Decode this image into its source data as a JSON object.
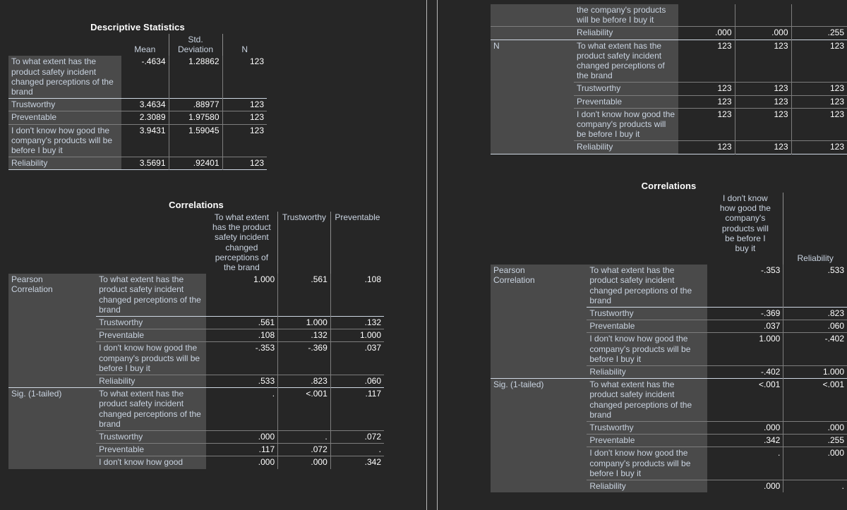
{
  "variables": {
    "v1": "To what extent has the product safety incident changed perceptions of the brand",
    "v2": "Trustworthy",
    "v3": "Preventable",
    "v4": "I don't know how good the company's products will be before I buy it",
    "v5": "Reliability"
  },
  "descriptives": {
    "title": "Descriptive Statistics",
    "columns": [
      "",
      "Mean",
      "Std. Deviation",
      "N"
    ],
    "col_mean": "Mean",
    "col_sd_line1": "Std.",
    "col_sd_line2": "Deviation",
    "col_n": "N",
    "rows": [
      {
        "label": "To what extent has the product safety incident changed perceptions of the brand",
        "mean": "-.4634",
        "sd": "1.28862",
        "n": "123"
      },
      {
        "label": "Trustworthy",
        "mean": "3.4634",
        "sd": ".88977",
        "n": "123"
      },
      {
        "label": "Preventable",
        "mean": "2.3089",
        "sd": "1.97580",
        "n": "123"
      },
      {
        "label": "I don't know how good the company's products will be before I buy it",
        "mean": "3.9431",
        "sd": "1.59045",
        "n": "123"
      },
      {
        "label": "Reliability",
        "mean": "3.5691",
        "sd": ".92401",
        "n": "123"
      }
    ]
  },
  "correlations_left": {
    "title": "Correlations",
    "columns": [
      "To what extent has the product safety incident changed perceptions of the brand",
      "Trustworthy",
      "Preventable"
    ],
    "sections": [
      {
        "name": "Pearson Correlation",
        "name_line1": "Pearson",
        "name_line2": "Correlation",
        "rows": [
          {
            "label": "To what extent has the product safety incident changed perceptions of the brand",
            "values": [
              "1.000",
              ".561",
              ".108"
            ]
          },
          {
            "label": "Trustworthy",
            "values": [
              ".561",
              "1.000",
              ".132"
            ]
          },
          {
            "label": "Preventable",
            "values": [
              ".108",
              ".132",
              "1.000"
            ]
          },
          {
            "label": "I don't know how good the company's products will be before I buy it",
            "values": [
              "-.353",
              "-.369",
              ".037"
            ]
          },
          {
            "label": "Reliability",
            "values": [
              ".533",
              ".823",
              ".060"
            ]
          }
        ]
      },
      {
        "name": "Sig. (1-tailed)",
        "name_line1": "Sig. (1-tailed)",
        "name_line2": "",
        "rows": [
          {
            "label": "To what extent has the product safety incident changed perceptions of the brand",
            "values": [
              ".",
              "<.001",
              ".117"
            ]
          },
          {
            "label": "Trustworthy",
            "values": [
              ".000",
              ".",
              ".072"
            ]
          },
          {
            "label": "Preventable",
            "values": [
              ".117",
              ".072",
              "."
            ]
          },
          {
            "label": "I don't know how good",
            "values": [
              ".000",
              ".000",
              ".342"
            ]
          }
        ]
      }
    ]
  },
  "correlations_right_top": {
    "columns": [
      "",
      "",
      ""
    ],
    "sig_tail_rows": [
      {
        "label": "the company's products will be before I buy it",
        "values": [
          "",
          "",
          ""
        ]
      },
      {
        "label": "Reliability",
        "values": [
          ".000",
          ".000",
          ".255"
        ]
      }
    ],
    "n_section": {
      "name": "N",
      "rows": [
        {
          "label": "To what extent has the product safety incident changed perceptions of the brand",
          "values": [
            "123",
            "123",
            "123"
          ]
        },
        {
          "label": "Trustworthy",
          "values": [
            "123",
            "123",
            "123"
          ]
        },
        {
          "label": "Preventable",
          "values": [
            "123",
            "123",
            "123"
          ]
        },
        {
          "label": "I don't know how good the company's products will be before I buy it",
          "values": [
            "123",
            "123",
            "123"
          ]
        },
        {
          "label": "Reliability",
          "values": [
            "123",
            "123",
            "123"
          ]
        }
      ]
    }
  },
  "correlations_right": {
    "title": "Correlations",
    "columns": [
      "I don't know how good the company's products will be before I buy it",
      "Reliability"
    ],
    "col1_lines": [
      "I don't know",
      "how good the",
      "company's",
      "products will",
      "be before I",
      "buy it"
    ],
    "col2_label": "Reliability",
    "sections": [
      {
        "name": "Pearson Correlation",
        "name_line1": "Pearson",
        "name_line2": "Correlation",
        "rows": [
          {
            "label": "To what extent has the product safety incident changed perceptions of the brand",
            "values": [
              "-.353",
              ".533"
            ]
          },
          {
            "label": "Trustworthy",
            "values": [
              "-.369",
              ".823"
            ]
          },
          {
            "label": "Preventable",
            "values": [
              ".037",
              ".060"
            ]
          },
          {
            "label": "I don't know how good the company's products will be before I buy it",
            "values": [
              "1.000",
              "-.402"
            ]
          },
          {
            "label": "Reliability",
            "values": [
              "-.402",
              "1.000"
            ]
          }
        ]
      },
      {
        "name": "Sig. (1-tailed)",
        "name_line1": "Sig. (1-tailed)",
        "name_line2": "",
        "rows": [
          {
            "label": "To what extent has the product safety incident changed perceptions of the brand",
            "values": [
              "<.001",
              "<.001"
            ]
          },
          {
            "label": "Trustworthy",
            "values": [
              ".000",
              ".000"
            ]
          },
          {
            "label": "Preventable",
            "values": [
              ".342",
              ".255"
            ]
          },
          {
            "label": "I don't know how good the company's products will be before I buy it",
            "values": [
              ".",
              ".000"
            ]
          },
          {
            "label": "Reliability",
            "values": [
              ".000",
              "."
            ]
          }
        ]
      }
    ]
  },
  "theme": {
    "page_bg": "#262626",
    "stub_bg": "#4a4a4a",
    "label_color": "#c9d3e0",
    "value_color": "#ffffff",
    "rule_color": "#cfd8e3"
  }
}
